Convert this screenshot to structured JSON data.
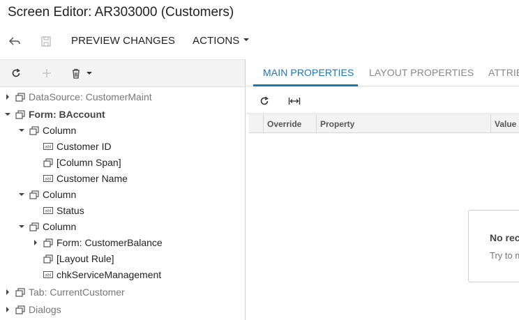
{
  "window": {
    "title": "Screen Editor: AR303000 (Customers)"
  },
  "toolbar": {
    "preview_label": "PREVIEW CHANGES",
    "actions_label": "ACTIONS"
  },
  "tree": {
    "nodes": [
      {
        "label": "DataSource: CustomerMaint"
      },
      {
        "label": "Form: BAccount"
      },
      {
        "label": "Column"
      },
      {
        "label": "Customer ID"
      },
      {
        "label": "[Column Span]"
      },
      {
        "label": "Customer Name"
      },
      {
        "label": "Column"
      },
      {
        "label": "Status"
      },
      {
        "label": "Column"
      },
      {
        "label": "Form: CustomerBalance"
      },
      {
        "label": "[Layout Rule]"
      },
      {
        "label": "chkServiceManagement"
      },
      {
        "label": "Tab: CurrentCustomer"
      },
      {
        "label": "Dialogs"
      }
    ]
  },
  "tabs": [
    {
      "label": "MAIN PROPERTIES"
    },
    {
      "label": "LAYOUT PROPERTIES"
    },
    {
      "label": "ATTRIB"
    }
  ],
  "grid": {
    "columns": [
      "Override",
      "Property",
      "Value"
    ]
  },
  "empty_state": {
    "title": "No rec",
    "hint": "Try to m"
  },
  "colors": {
    "accent": "#1b75bb",
    "panel_bg": "#f4f4f4"
  }
}
